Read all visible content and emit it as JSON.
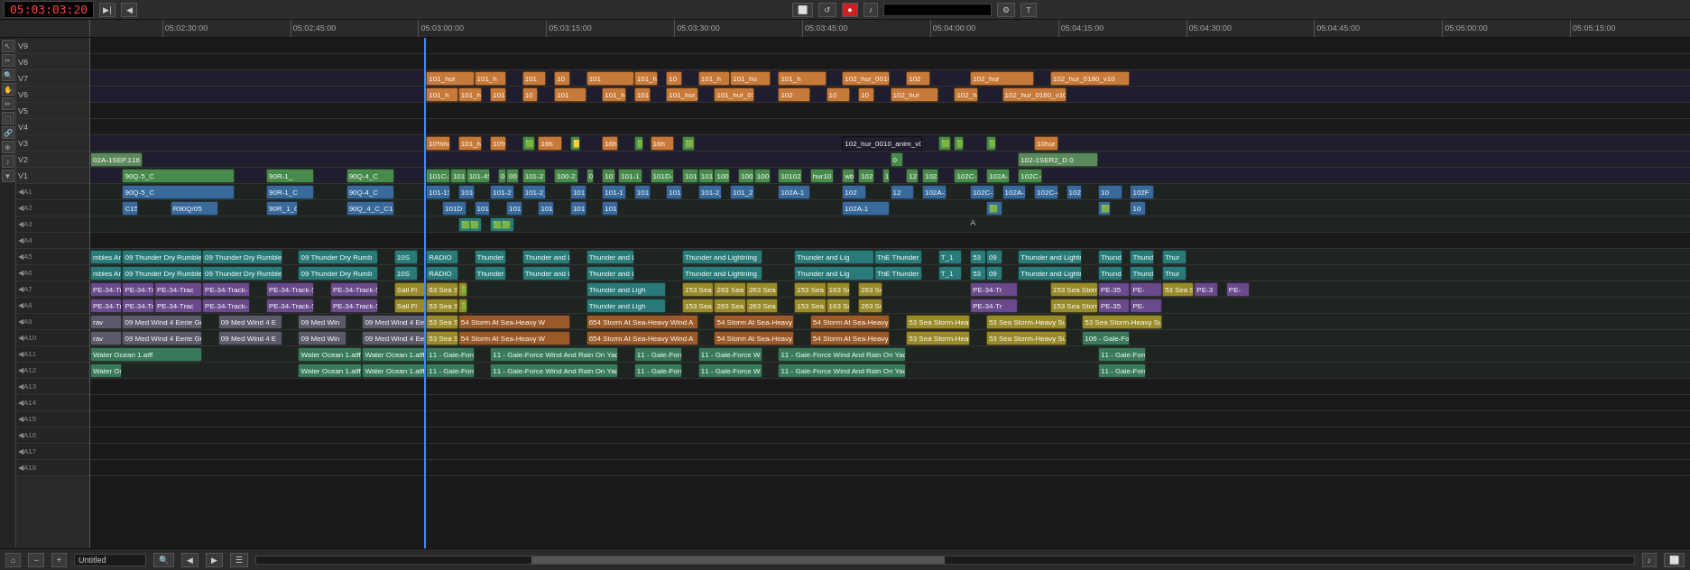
{
  "toolbar": {
    "timecode": "05:03:03:20",
    "transport_buttons": [
      "◀◀",
      "◀",
      "▶",
      "▶▶",
      "⬛"
    ],
    "tools": [
      "✂",
      "⚙",
      "T"
    ],
    "record_btn": "●"
  },
  "ruler": {
    "marks": [
      {
        "label": "05:02:30:00",
        "pct": 4.5
      },
      {
        "label": "05:02:45:00",
        "pct": 12.5
      },
      {
        "label": "05:03:00:00",
        "pct": 20.5
      },
      {
        "label": "05:03:15:00",
        "pct": 28.5
      },
      {
        "label": "05:03:30:00",
        "pct": 36.5
      },
      {
        "label": "05:03:45:00",
        "pct": 44.5
      },
      {
        "label": "05:04:00:00",
        "pct": 52.5
      },
      {
        "label": "05:04:15:00",
        "pct": 60.5
      },
      {
        "label": "05:04:30:00",
        "pct": 68.5
      },
      {
        "label": "05:04:45:00",
        "pct": 76.5
      },
      {
        "label": "05:05:00:00",
        "pct": 84.5
      },
      {
        "label": "05:05:15:00",
        "pct": 92.5
      }
    ]
  },
  "tracks": [
    {
      "id": "V9",
      "type": "video",
      "label": "V9"
    },
    {
      "id": "V8",
      "type": "video",
      "label": "V8"
    },
    {
      "id": "V7",
      "type": "video",
      "label": "V7"
    },
    {
      "id": "V6",
      "type": "video",
      "label": "V6"
    },
    {
      "id": "V5",
      "type": "video",
      "label": "V5"
    },
    {
      "id": "V4",
      "type": "video",
      "label": "V4"
    },
    {
      "id": "V3",
      "type": "video",
      "label": "V3"
    },
    {
      "id": "V2",
      "type": "video",
      "label": "V2"
    },
    {
      "id": "V1",
      "type": "video",
      "label": "V1"
    },
    {
      "id": "A1",
      "type": "audio",
      "label": "A1"
    },
    {
      "id": "A2",
      "type": "audio",
      "label": "A2"
    },
    {
      "id": "A3",
      "type": "audio",
      "label": "A3"
    },
    {
      "id": "A4",
      "type": "audio",
      "label": "A4"
    },
    {
      "id": "A5",
      "type": "audio",
      "label": "A5"
    },
    {
      "id": "A6",
      "type": "audio",
      "label": "A6"
    },
    {
      "id": "A7",
      "type": "audio",
      "label": "A7"
    },
    {
      "id": "A8",
      "type": "audio",
      "label": "A8"
    },
    {
      "id": "A9",
      "type": "audio",
      "label": "A9"
    },
    {
      "id": "A10",
      "type": "audio",
      "label": "A10"
    },
    {
      "id": "A11",
      "type": "audio",
      "label": "A11"
    },
    {
      "id": "A12",
      "type": "audio",
      "label": "A12"
    },
    {
      "id": "A13",
      "type": "audio",
      "label": "A13"
    },
    {
      "id": "A14",
      "type": "audio",
      "label": "A14"
    },
    {
      "id": "A15",
      "type": "audio",
      "label": "A15"
    },
    {
      "id": "A16",
      "type": "audio",
      "label": "A16"
    },
    {
      "id": "A17",
      "type": "audio",
      "label": "A17"
    },
    {
      "id": "A18",
      "type": "audio",
      "label": "A18"
    }
  ],
  "bottom": {
    "project_name": "Untitled",
    "zoom_icon": "🔍"
  }
}
